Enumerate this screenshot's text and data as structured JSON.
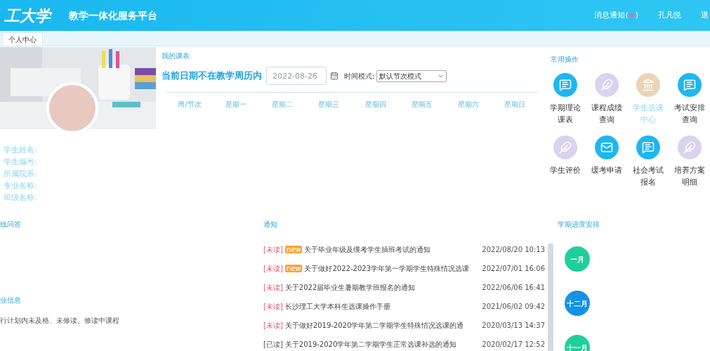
{
  "header": {
    "logo": "工大学",
    "title": "教学一体化服务平台",
    "notice_link": "消息通知(",
    "notice_close": ")",
    "has_unread": true,
    "user": "孔凡悦",
    "logout": "退"
  },
  "tabs": [
    {
      "label": "个人中心",
      "selected": true
    }
  ],
  "profile": {
    "fields": [
      {
        "label": "学生姓名:"
      },
      {
        "label": "学生编号:"
      },
      {
        "label": "所属院系:"
      },
      {
        "label": "专业名称:"
      },
      {
        "label": "班级名称:"
      }
    ]
  },
  "timetable": {
    "title": "我的课表",
    "message": "当前日期不在教学周历内",
    "date": "2022-08-26",
    "mode_label": "时间模式:",
    "mode": "默认节次模式",
    "columns": [
      "周/节次",
      "星期一",
      "星期二",
      "星期三",
      "星期四",
      "星期五",
      "星期六",
      "星期日"
    ]
  },
  "shortcuts": {
    "title": "常用操作",
    "items": [
      {
        "label": "学期理论课表",
        "kind": "chat",
        "color": "#1fb6f0",
        "selected": false
      },
      {
        "label": "课程成绩查询",
        "kind": "pen",
        "color": "#d9d3ee",
        "selected": false
      },
      {
        "label": "学生选课中心",
        "kind": "bank",
        "color": "#ecd3b8",
        "selected": true
      },
      {
        "label": "考试安排查询",
        "kind": "chat",
        "color": "#1fb6f0",
        "selected": false
      },
      {
        "label": "学生评价",
        "kind": "pen",
        "color": "#d9d3ee",
        "selected": false
      },
      {
        "label": "缓考申请",
        "kind": "mail",
        "color": "#1fb6f0",
        "selected": false
      },
      {
        "label": "社会考试报名",
        "kind": "chat",
        "color": "#1fb6f0",
        "selected": false
      },
      {
        "label": "培养方案明细",
        "kind": "pen",
        "color": "#d9d3ee",
        "selected": false
      }
    ]
  },
  "qa": {
    "title": "线问答"
  },
  "major": {
    "title": "业信息",
    "text": "行计划内未及格、未修读、修读中课程"
  },
  "notices": {
    "title": "通知",
    "items": [
      {
        "status": "[未读]",
        "read": false,
        "new": true,
        "badge": "new",
        "title": "关于毕业年级及缓考学生插班考试的通知",
        "date": "2022/08/20 10:13"
      },
      {
        "status": "[未读]",
        "read": false,
        "new": true,
        "badge": "new",
        "title": "关于做好2022-2023学年第一学期学生特殊情况选课",
        "date": "2022/07/01 16:06"
      },
      {
        "status": "[未读]",
        "read": false,
        "new": false,
        "title": "关于2022届毕业生暑期教学班报名的通知",
        "date": "2022/06/06 16:41"
      },
      {
        "status": "[未读]",
        "read": false,
        "new": false,
        "title": "长沙理工大学本科生选课操作手册",
        "date": "2021/06/02 09:42"
      },
      {
        "status": "[未读]",
        "read": false,
        "new": false,
        "title": "关于做好2019-2020学年第二学期学生特殊情况选课的通",
        "date": "2020/03/13 14:37"
      },
      {
        "status": "[已读]",
        "read": true,
        "new": false,
        "title": "关于2019-2020学年第二学期学生正常选课补选的通知",
        "date": "2020/02/17 12:52"
      }
    ]
  },
  "progress": {
    "title": "学期进度安排",
    "months": [
      {
        "label": "一月",
        "color": "#1fcf9b"
      },
      {
        "label": "十二月",
        "color": "#1592e6"
      },
      {
        "label": "十一月",
        "color": "#1fcf9b"
      }
    ]
  }
}
